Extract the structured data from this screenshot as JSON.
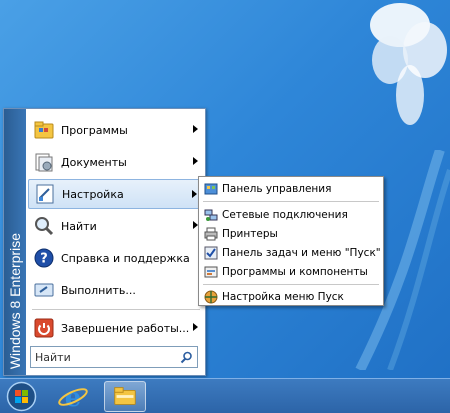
{
  "start_menu": {
    "banner": "Windows 8 Enterprise",
    "items": [
      {
        "label": "Программы",
        "icon": "programs-folder-icon",
        "has_submenu": true
      },
      {
        "label": "Документы",
        "icon": "documents-icon",
        "has_submenu": true
      },
      {
        "label": "Настройка",
        "icon": "settings-icon",
        "has_submenu": true,
        "active": true
      },
      {
        "label": "Найти",
        "icon": "search-magnifier-icon",
        "has_submenu": true
      },
      {
        "label": "Справка и поддержка",
        "icon": "help-icon",
        "has_submenu": false
      },
      {
        "label": "Выполнить...",
        "icon": "run-icon",
        "has_submenu": false
      },
      {
        "label": "Завершение работы...",
        "icon": "shutdown-icon",
        "has_submenu": true
      }
    ],
    "search_placeholder": "Найти"
  },
  "submenu": {
    "items": [
      {
        "label": "Панель управления",
        "icon": "control-panel-icon"
      },
      {
        "label": "Сетевые подключения",
        "icon": "network-connections-icon"
      },
      {
        "label": "Принтеры",
        "icon": "printers-icon"
      },
      {
        "label": "Панель задач и меню \"Пуск\"",
        "icon": "taskbar-start-icon"
      },
      {
        "label": "Программы и компоненты",
        "icon": "programs-features-icon"
      },
      {
        "label": "Настройка меню Пуск",
        "icon": "start-menu-settings-icon"
      }
    ]
  },
  "taskbar": {
    "buttons": [
      {
        "icon": "start-orb-icon"
      },
      {
        "icon": "internet-explorer-icon"
      },
      {
        "icon": "file-explorer-icon",
        "active": true
      }
    ]
  },
  "colors": {
    "desktop": "#2e86d8",
    "banner": "#2a5d93",
    "taskbar": "#3d7bc0",
    "highlight": "#cfe2f6"
  }
}
